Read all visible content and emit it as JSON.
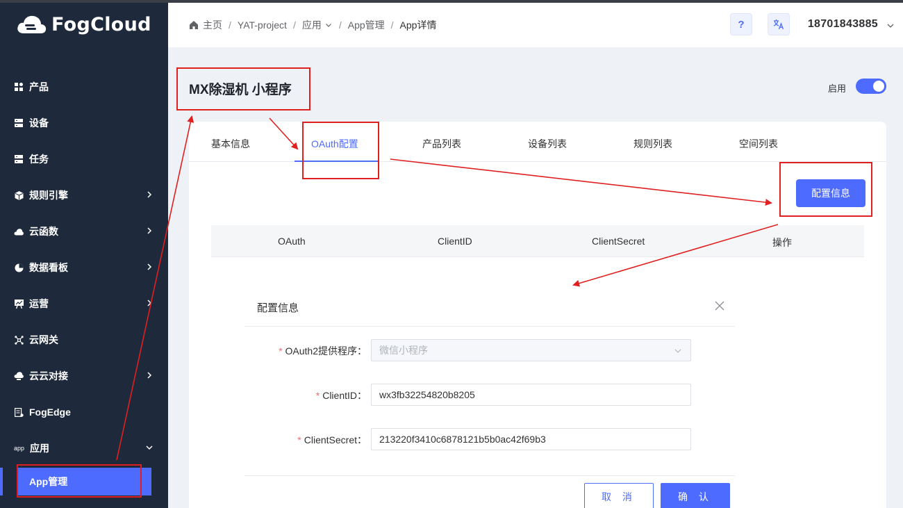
{
  "brand": {
    "name": "FogCloud"
  },
  "sidebar": {
    "items": [
      {
        "label": "产品",
        "icon": "grid-icon",
        "has_chevron": false
      },
      {
        "label": "设备",
        "icon": "server-icon",
        "has_chevron": false
      },
      {
        "label": "任务",
        "icon": "server-icon",
        "has_chevron": false
      },
      {
        "label": "规则引擎",
        "icon": "cube-icon",
        "has_chevron": true
      },
      {
        "label": "云函数",
        "icon": "cloud-icon",
        "has_chevron": true
      },
      {
        "label": "数据看板",
        "icon": "pie-icon",
        "has_chevron": true
      },
      {
        "label": "运营",
        "icon": "chart-board-icon",
        "has_chevron": true
      },
      {
        "label": "云网关",
        "icon": "network-icon",
        "has_chevron": false
      },
      {
        "label": "云云对接",
        "icon": "cloud-link-icon",
        "has_chevron": true
      },
      {
        "label": "FogEdge",
        "icon": "edge-icon",
        "has_chevron": false
      },
      {
        "label": "应用",
        "icon_text": "app",
        "has_chevron": true
      }
    ],
    "active_sub": "App管理"
  },
  "header": {
    "breadcrumb": [
      "主页",
      "YAT-project",
      "应用",
      "App管理",
      "App详情"
    ],
    "help_label": "?",
    "translate_label": "文A",
    "user": "18701843885"
  },
  "page": {
    "title": "MX除湿机 小程序",
    "enable_label": "启用",
    "enabled": true
  },
  "tabs": [
    "基本信息",
    "OAuth配置",
    "产品列表",
    "设备列表",
    "规则列表",
    "空间列表"
  ],
  "active_tab": "OAuth配置",
  "config_button": "配置信息",
  "table": {
    "columns": [
      "OAuth",
      "ClientID",
      "ClientSecret",
      "操作"
    ]
  },
  "dialog": {
    "title": "配置信息",
    "fields": [
      {
        "label": "OAuth2提供程序：",
        "value": "微信小程序",
        "required": true,
        "disabled": true
      },
      {
        "label": "ClientID：",
        "value": "wx3fb32254820b8205",
        "required": true,
        "disabled": false
      },
      {
        "label": "ClientSecret：",
        "value": "213220f3410c6878121b5b0ac42f69b3",
        "required": true,
        "disabled": false
      }
    ],
    "cancel_label": "取 消",
    "confirm_label": "确 认"
  },
  "colors": {
    "primary": "#4d6bff",
    "sidebar_bg": "#1e2a3b",
    "annotation": "#e02020"
  }
}
